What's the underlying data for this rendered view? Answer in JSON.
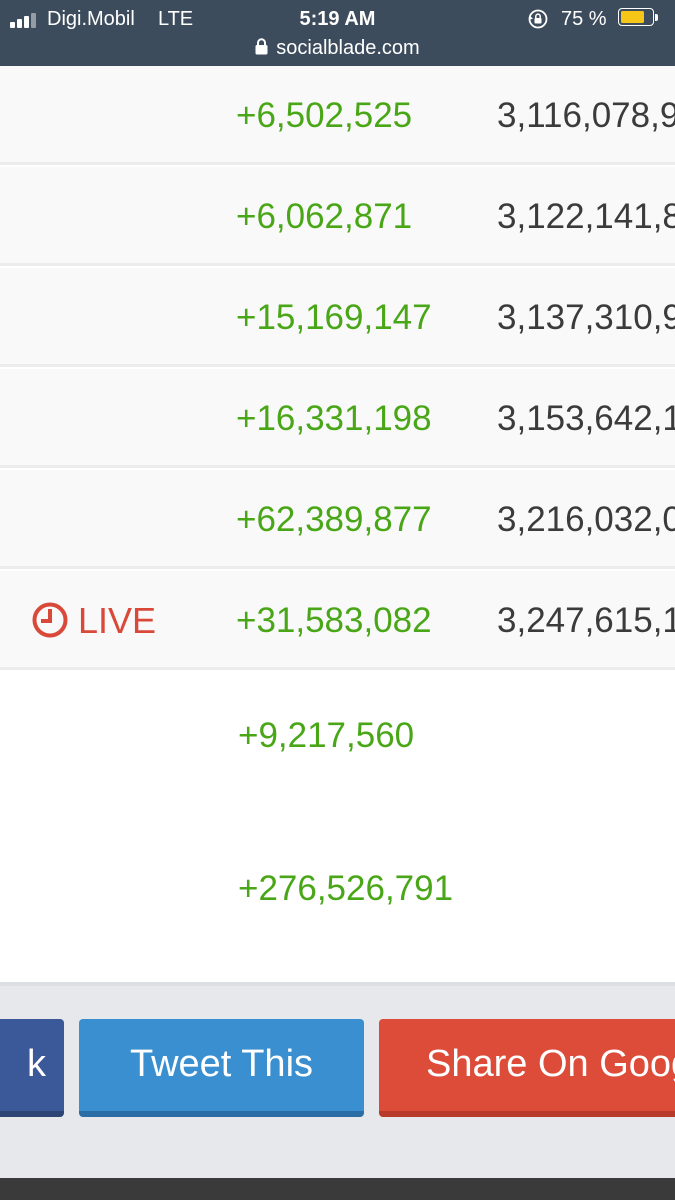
{
  "status_bar": {
    "carrier": "Digi.Mobil",
    "network": "LTE",
    "time": "5:19 AM",
    "battery_percent": "75 %",
    "battery_level": 0.75,
    "battery_color": "#f5c518"
  },
  "browser": {
    "url": "socialblade.com"
  },
  "table": {
    "rows": [
      {
        "change": "+6,502,525",
        "total": "3,116,078,9"
      },
      {
        "change": "+6,062,871",
        "total": "3,122,141,8"
      },
      {
        "change": "+15,169,147",
        "total": "3,137,310,9"
      },
      {
        "change": "+16,331,198",
        "total": "3,153,642,1"
      },
      {
        "change": "+62,389,877",
        "total": "3,216,032,0"
      },
      {
        "label": "LIVE",
        "change": "+31,583,082",
        "total": "3,247,615,1"
      }
    ]
  },
  "summary": {
    "first": "+9,217,560",
    "second": "+276,526,791"
  },
  "share": {
    "facebook_label": "k",
    "twitter_label": "Tweet This",
    "google_label": "Share On Goog"
  },
  "colors": {
    "positive": "#49a617",
    "live": "#d9493a",
    "facebook": "#3b5998",
    "twitter": "#3a8fd0",
    "google": "#dd4b39"
  }
}
